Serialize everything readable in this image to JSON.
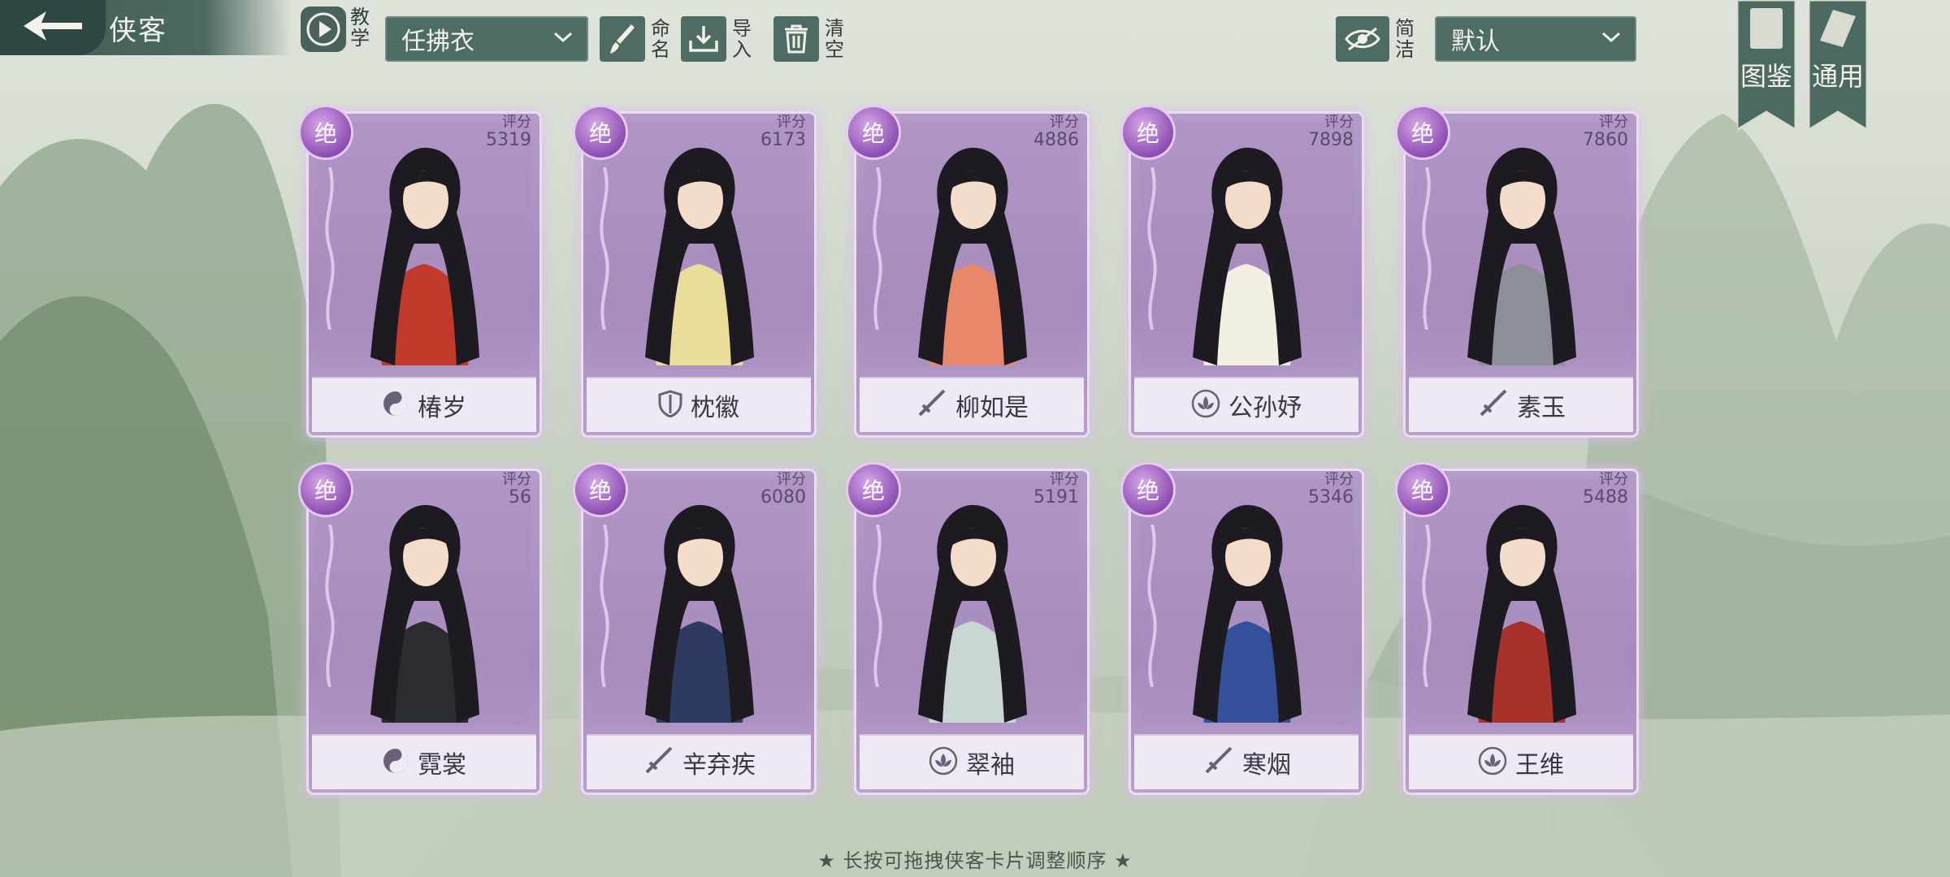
{
  "header": {
    "title": "侠客",
    "tutorial_label": "教学",
    "preset_selected": "任拂衣",
    "rename_label": "命名",
    "import_label": "导入",
    "clear_label": "清空",
    "simple_label": "简洁",
    "sort_selected": "默认"
  },
  "side_tabs": [
    {
      "label": "图鉴"
    },
    {
      "label": "通用"
    }
  ],
  "cards": [
    {
      "badge": "绝",
      "score_label": "评分",
      "score": "5319",
      "name": "椿岁",
      "role_icon": "yin-yang-icon",
      "color": "#c0392b"
    },
    {
      "badge": "绝",
      "score_label": "评分",
      "score": "6173",
      "name": "枕徽",
      "role_icon": "shield-icon",
      "color": "#e9dd9a"
    },
    {
      "badge": "绝",
      "score_label": "评分",
      "score": "4886",
      "name": "柳如是",
      "role_icon": "sword-icon",
      "color": "#e8876a"
    },
    {
      "badge": "绝",
      "score_label": "评分",
      "score": "7898",
      "name": "公孙妤",
      "role_icon": "lotus-icon",
      "color": "#f3efe2"
    },
    {
      "badge": "绝",
      "score_label": "评分",
      "score": "7860",
      "name": "素玉",
      "role_icon": "sword-icon",
      "color": "#8c8f96"
    },
    {
      "badge": "绝",
      "score_label": "评分",
      "score": "56",
      "name": "霓裳",
      "role_icon": "yin-yang-icon",
      "color": "#2b2b30"
    },
    {
      "badge": "绝",
      "score_label": "评分",
      "score": "6080",
      "name": "辛弃疾",
      "role_icon": "sword-icon",
      "color": "#2d3b62"
    },
    {
      "badge": "绝",
      "score_label": "评分",
      "score": "5191",
      "name": "翠袖",
      "role_icon": "lotus-icon",
      "color": "#c9d6d2"
    },
    {
      "badge": "绝",
      "score_label": "评分",
      "score": "5346",
      "name": "寒烟",
      "role_icon": "sword-icon",
      "color": "#34509a"
    },
    {
      "badge": "绝",
      "score_label": "评分",
      "score": "5488",
      "name": "王维",
      "role_icon": "lotus-icon",
      "color": "#a8322b"
    }
  ],
  "footer_hint": "★ 长按可拖拽侠客卡片调整顺序 ★"
}
